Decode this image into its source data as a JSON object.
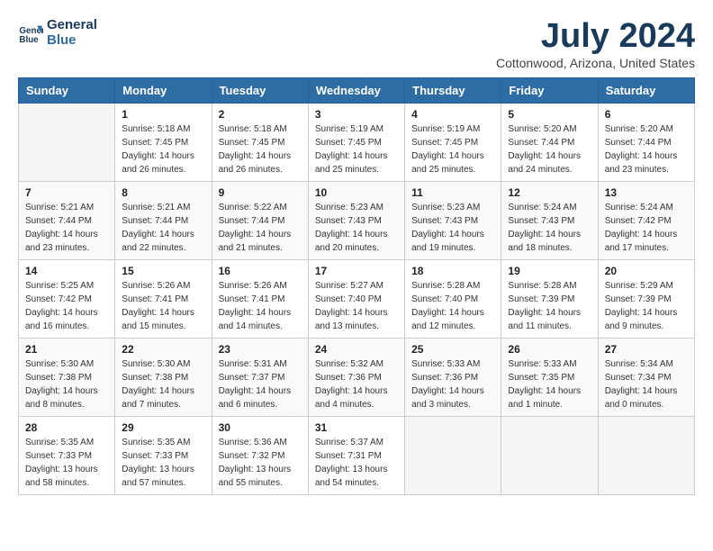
{
  "logo": {
    "name": "General",
    "name2": "Blue"
  },
  "title": "July 2024",
  "location": "Cottonwood, Arizona, United States",
  "days_of_week": [
    "Sunday",
    "Monday",
    "Tuesday",
    "Wednesday",
    "Thursday",
    "Friday",
    "Saturday"
  ],
  "weeks": [
    [
      {
        "day": "",
        "info": ""
      },
      {
        "day": "1",
        "info": "Sunrise: 5:18 AM\nSunset: 7:45 PM\nDaylight: 14 hours\nand 26 minutes."
      },
      {
        "day": "2",
        "info": "Sunrise: 5:18 AM\nSunset: 7:45 PM\nDaylight: 14 hours\nand 26 minutes."
      },
      {
        "day": "3",
        "info": "Sunrise: 5:19 AM\nSunset: 7:45 PM\nDaylight: 14 hours\nand 25 minutes."
      },
      {
        "day": "4",
        "info": "Sunrise: 5:19 AM\nSunset: 7:45 PM\nDaylight: 14 hours\nand 25 minutes."
      },
      {
        "day": "5",
        "info": "Sunrise: 5:20 AM\nSunset: 7:44 PM\nDaylight: 14 hours\nand 24 minutes."
      },
      {
        "day": "6",
        "info": "Sunrise: 5:20 AM\nSunset: 7:44 PM\nDaylight: 14 hours\nand 23 minutes."
      }
    ],
    [
      {
        "day": "7",
        "info": "Sunrise: 5:21 AM\nSunset: 7:44 PM\nDaylight: 14 hours\nand 23 minutes."
      },
      {
        "day": "8",
        "info": "Sunrise: 5:21 AM\nSunset: 7:44 PM\nDaylight: 14 hours\nand 22 minutes."
      },
      {
        "day": "9",
        "info": "Sunrise: 5:22 AM\nSunset: 7:44 PM\nDaylight: 14 hours\nand 21 minutes."
      },
      {
        "day": "10",
        "info": "Sunrise: 5:23 AM\nSunset: 7:43 PM\nDaylight: 14 hours\nand 20 minutes."
      },
      {
        "day": "11",
        "info": "Sunrise: 5:23 AM\nSunset: 7:43 PM\nDaylight: 14 hours\nand 19 minutes."
      },
      {
        "day": "12",
        "info": "Sunrise: 5:24 AM\nSunset: 7:43 PM\nDaylight: 14 hours\nand 18 minutes."
      },
      {
        "day": "13",
        "info": "Sunrise: 5:24 AM\nSunset: 7:42 PM\nDaylight: 14 hours\nand 17 minutes."
      }
    ],
    [
      {
        "day": "14",
        "info": "Sunrise: 5:25 AM\nSunset: 7:42 PM\nDaylight: 14 hours\nand 16 minutes."
      },
      {
        "day": "15",
        "info": "Sunrise: 5:26 AM\nSunset: 7:41 PM\nDaylight: 14 hours\nand 15 minutes."
      },
      {
        "day": "16",
        "info": "Sunrise: 5:26 AM\nSunset: 7:41 PM\nDaylight: 14 hours\nand 14 minutes."
      },
      {
        "day": "17",
        "info": "Sunrise: 5:27 AM\nSunset: 7:40 PM\nDaylight: 14 hours\nand 13 minutes."
      },
      {
        "day": "18",
        "info": "Sunrise: 5:28 AM\nSunset: 7:40 PM\nDaylight: 14 hours\nand 12 minutes."
      },
      {
        "day": "19",
        "info": "Sunrise: 5:28 AM\nSunset: 7:39 PM\nDaylight: 14 hours\nand 11 minutes."
      },
      {
        "day": "20",
        "info": "Sunrise: 5:29 AM\nSunset: 7:39 PM\nDaylight: 14 hours\nand 9 minutes."
      }
    ],
    [
      {
        "day": "21",
        "info": "Sunrise: 5:30 AM\nSunset: 7:38 PM\nDaylight: 14 hours\nand 8 minutes."
      },
      {
        "day": "22",
        "info": "Sunrise: 5:30 AM\nSunset: 7:38 PM\nDaylight: 14 hours\nand 7 minutes."
      },
      {
        "day": "23",
        "info": "Sunrise: 5:31 AM\nSunset: 7:37 PM\nDaylight: 14 hours\nand 6 minutes."
      },
      {
        "day": "24",
        "info": "Sunrise: 5:32 AM\nSunset: 7:36 PM\nDaylight: 14 hours\nand 4 minutes."
      },
      {
        "day": "25",
        "info": "Sunrise: 5:33 AM\nSunset: 7:36 PM\nDaylight: 14 hours\nand 3 minutes."
      },
      {
        "day": "26",
        "info": "Sunrise: 5:33 AM\nSunset: 7:35 PM\nDaylight: 14 hours\nand 1 minute."
      },
      {
        "day": "27",
        "info": "Sunrise: 5:34 AM\nSunset: 7:34 PM\nDaylight: 14 hours\nand 0 minutes."
      }
    ],
    [
      {
        "day": "28",
        "info": "Sunrise: 5:35 AM\nSunset: 7:33 PM\nDaylight: 13 hours\nand 58 minutes."
      },
      {
        "day": "29",
        "info": "Sunrise: 5:35 AM\nSunset: 7:33 PM\nDaylight: 13 hours\nand 57 minutes."
      },
      {
        "day": "30",
        "info": "Sunrise: 5:36 AM\nSunset: 7:32 PM\nDaylight: 13 hours\nand 55 minutes."
      },
      {
        "day": "31",
        "info": "Sunrise: 5:37 AM\nSunset: 7:31 PM\nDaylight: 13 hours\nand 54 minutes."
      },
      {
        "day": "",
        "info": ""
      },
      {
        "day": "",
        "info": ""
      },
      {
        "day": "",
        "info": ""
      }
    ]
  ]
}
